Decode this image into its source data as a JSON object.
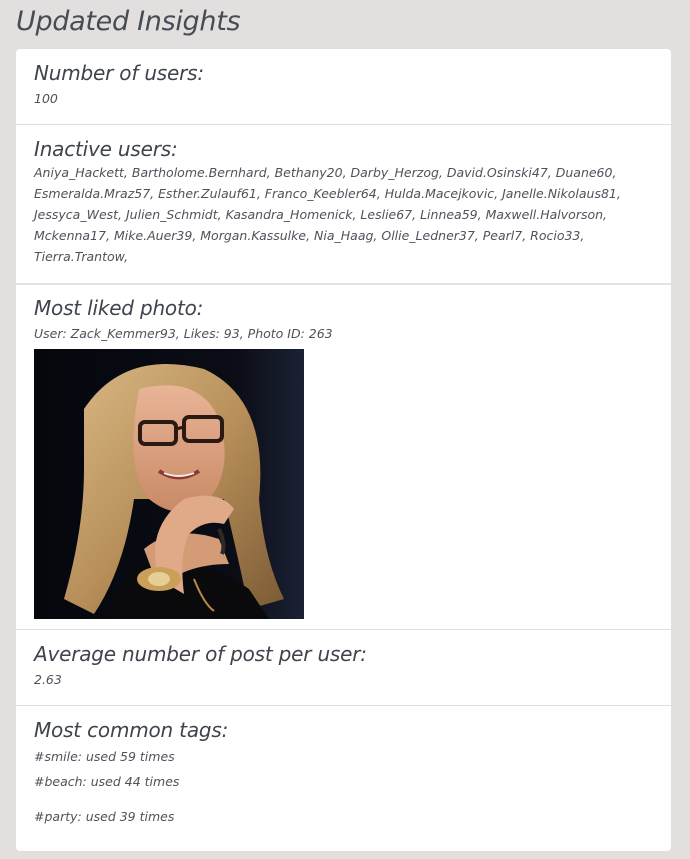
{
  "page": {
    "title": "Updated Insights"
  },
  "number_of_users": {
    "heading": "Number of users:",
    "value": "100"
  },
  "inactive_users": {
    "heading": "Inactive users:",
    "list": "Aniya_Hackett, Bartholome.Bernhard, Bethany20, Darby_Herzog, David.Osinski47, Duane60, Esmeralda.Mraz57, Esther.Zulauf61, Franco_Keebler64, Hulda.Macejkovic, Janelle.Nikolaus81, Jessyca_West, Julien_Schmidt, Kasandra_Homenick, Leslie67, Linnea59, Maxwell.Halvorson, Mckenna17, Mike.Auer39, Morgan.Kassulke, Nia_Haag, Ollie_Ledner37, Pearl7, Rocio33, Tierra.Trantow,"
  },
  "most_liked_photo": {
    "heading": "Most liked photo:",
    "details": "User: Zack_Kemmer93, Likes: 93, Photo ID: 263"
  },
  "average_posts": {
    "heading": "Average number of post per user:",
    "value": "2.63"
  },
  "common_tags": {
    "heading": "Most common tags:",
    "tags": [
      "#smile: used 59 times",
      "#beach: used 44 times",
      "#party: used 39 times"
    ]
  }
}
